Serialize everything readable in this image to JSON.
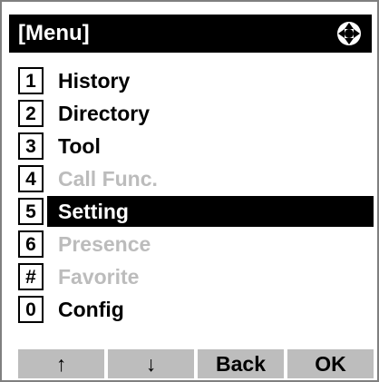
{
  "header": {
    "title": "[Menu]",
    "icon": "four-way-navigation-icon"
  },
  "menu": {
    "items": [
      {
        "key": "1",
        "label": "History",
        "state": "enabled"
      },
      {
        "key": "2",
        "label": "Directory",
        "state": "enabled"
      },
      {
        "key": "3",
        "label": "Tool",
        "state": "enabled"
      },
      {
        "key": "4",
        "label": "Call Func.",
        "state": "disabled"
      },
      {
        "key": "5",
        "label": "Setting",
        "state": "selected"
      },
      {
        "key": "6",
        "label": "Presence",
        "state": "disabled"
      },
      {
        "key": "#",
        "label": "Favorite",
        "state": "disabled"
      },
      {
        "key": "0",
        "label": "Config",
        "state": "enabled"
      }
    ]
  },
  "softkeys": [
    {
      "label": "↑",
      "name": "up-softkey"
    },
    {
      "label": "↓",
      "name": "down-softkey"
    },
    {
      "label": "Back",
      "name": "back-softkey"
    },
    {
      "label": "OK",
      "name": "ok-softkey"
    }
  ],
  "colors": {
    "header_bg": "#000000",
    "disabled_text": "#bcbcbc",
    "selected_bg": "#000000",
    "softkey_bg": "#bdbdbd"
  }
}
